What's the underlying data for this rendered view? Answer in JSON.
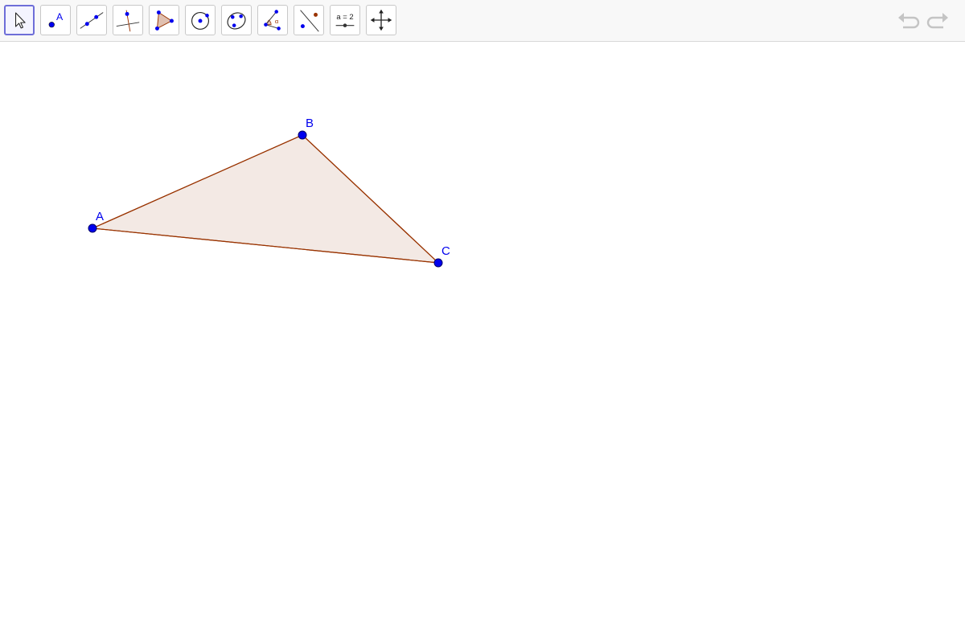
{
  "toolbar": {
    "tools": [
      {
        "name": "move-tool",
        "icon": "arrow-cursor-icon",
        "selected": true
      },
      {
        "name": "point-tool",
        "icon": "point-icon",
        "label": "A"
      },
      {
        "name": "line-tool",
        "icon": "line-through-two-points-icon"
      },
      {
        "name": "perpendicular-line-tool",
        "icon": "perpendicular-line-icon"
      },
      {
        "name": "polygon-tool",
        "icon": "polygon-icon"
      },
      {
        "name": "circle-tool",
        "icon": "circle-center-point-icon"
      },
      {
        "name": "ellipse-tool",
        "icon": "ellipse-icon"
      },
      {
        "name": "angle-tool",
        "icon": "angle-icon",
        "label": "α"
      },
      {
        "name": "reflect-tool",
        "icon": "reflect-about-line-icon"
      },
      {
        "name": "slider-tool",
        "icon": "slider-icon",
        "label": "a = 2"
      },
      {
        "name": "move-graphics-view-tool",
        "icon": "move-graphics-view-icon"
      }
    ],
    "undo_icon": "undo-icon",
    "redo_icon": "redo-icon"
  },
  "graphics": {
    "points": [
      {
        "label": "A"
      },
      {
        "label": "B"
      },
      {
        "label": "C"
      }
    ],
    "polygon": {
      "vertices": [
        "A",
        "B",
        "C"
      ],
      "fill": "#f3e9e4",
      "stroke": "#993300"
    },
    "point_color": "#0000ee"
  },
  "colors": {
    "accent": "#6e6ed8",
    "point": "#0000ee",
    "polygon_stroke": "#993300",
    "polygon_fill": "#f3e9e4"
  }
}
